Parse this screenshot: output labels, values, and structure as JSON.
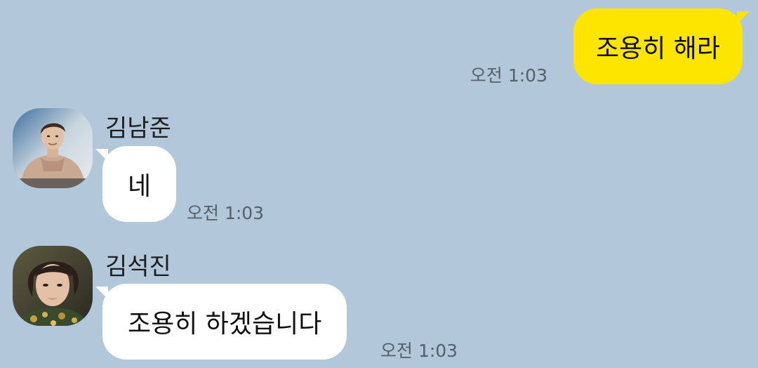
{
  "outgoing": {
    "text": "조용히 해라",
    "time": "오전 1:03",
    "bubble_color": "#fee500"
  },
  "incoming": [
    {
      "sender": "김남준",
      "text": "네",
      "time": "오전 1:03",
      "avatar_icon": "profile-photo"
    },
    {
      "sender": "김석진",
      "text": "조용히 하겠습니다",
      "time": "오전 1:03",
      "avatar_icon": "profile-photo"
    }
  ],
  "colors": {
    "background": "#b2c7da",
    "incoming_bubble": "#ffffff",
    "time_text": "#55606a"
  }
}
